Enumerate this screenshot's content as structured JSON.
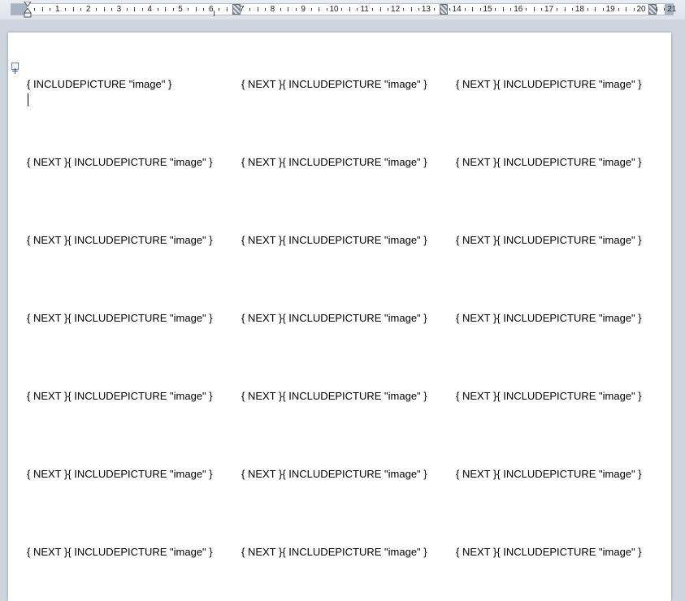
{
  "ruler": {
    "numbers": [
      "1",
      "2",
      "3",
      "4",
      "5",
      "6",
      "7",
      "8",
      "9",
      "10",
      "11",
      "12",
      "13",
      "14",
      "15",
      "16",
      "17",
      "18",
      "19",
      "20",
      "21"
    ]
  },
  "document": {
    "first_field": "{ INCLUDEPICTURE \"image\" }",
    "next_field": "{ NEXT }",
    "include_field": "{ INCLUDEPICTURE \"image\" }",
    "rows": 7,
    "columns": 3
  }
}
